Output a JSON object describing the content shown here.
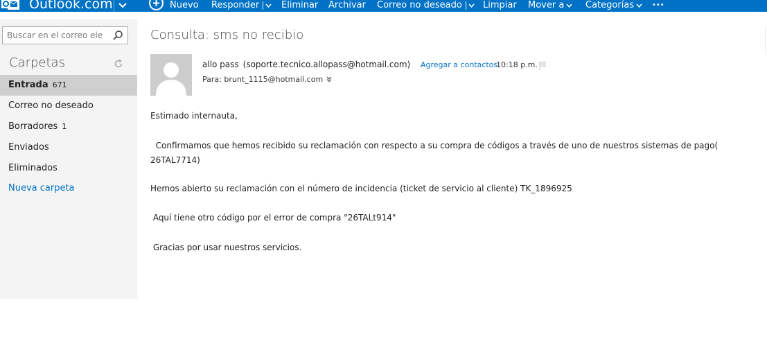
{
  "brand": {
    "name": "Outlook.com",
    "logo_icon": "outlook-logo-icon",
    "chevron_icon": "chevron-down-icon"
  },
  "toolbar": {
    "new_icon": "plus-circle-icon",
    "new_label": "Nuevo",
    "reply_label": "Responder",
    "delete_label": "Eliminar",
    "archive_label": "Archivar",
    "junk_label": "Correo no deseado",
    "sweep_label": "Limpiar",
    "move_label": "Mover a",
    "categories_label": "Categorías",
    "more_label": "•••"
  },
  "search": {
    "placeholder": "Buscar en el correo ele",
    "icon": "search-icon"
  },
  "folders": {
    "heading": "Carpetas",
    "refresh_icon": "refresh-icon",
    "items": [
      {
        "label": "Entrada",
        "count": "671",
        "selected": true
      },
      {
        "label": "Correo no deseado",
        "count": ""
      },
      {
        "label": "Borradores",
        "count": "1"
      },
      {
        "label": "Enviados",
        "count": ""
      },
      {
        "label": "Eliminados",
        "count": ""
      }
    ],
    "new_folder_label": "Nueva carpeta"
  },
  "message": {
    "subject": "Consulta: sms no recibio",
    "sender_name": "allo pass",
    "sender_email": "(soporte.tecnico.allopass@hotmail.com)",
    "add_contact_label": "Agregar a contactos",
    "time": "10:18 p.m.",
    "flag_icon": "flag-icon",
    "to_line": "Para: brunt_1115@hotmail.com",
    "avatar_icon": "person-avatar-icon",
    "body": [
      "Estimado internauta,",
      "  Confirmamos que hemos recibido su reclamación con respecto a su compra de códigos a través de uno de nuestros sistemas de pago(",
      "26TAL7714)",
      "Hemos abierto su reclamación con el número de incidencia (ticket de servicio al cliente) TK_1896925",
      " Aquí tiene otro código por el error de compra \"26TALt914\"",
      " Gracias por usar nuestros servicios."
    ]
  },
  "colors": {
    "accent": "#0072c6",
    "sidebar_bg": "#f4f4f4",
    "selected_bg": "#cfcfcf"
  }
}
